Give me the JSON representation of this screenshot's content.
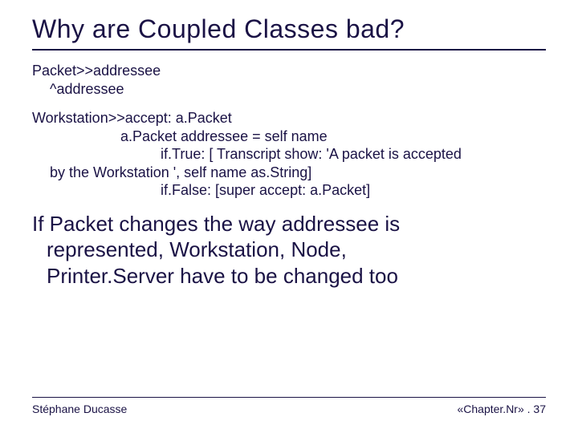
{
  "title": "Why are Coupled Classes bad?",
  "code1": {
    "l1": "Packet>>addressee",
    "l2": "^addressee"
  },
  "code2": {
    "l1": "Workstation>>accept: a.Packet",
    "l2": "a.Packet addressee = self name",
    "l3": "if.True: [ Transcript show: 'A packet  is accepted",
    "l4": "by the Workstation ', self name as.String]",
    "l5": "if.False: [super accept: a.Packet]"
  },
  "body": {
    "l1": "If Packet changes the way addressee is",
    "l2": "represented, Workstation, Node,",
    "l3": "Printer.Server have to be changed too"
  },
  "footer": {
    "author": "Stéphane Ducasse",
    "pageref": "«Chapter.Nr» . 37"
  }
}
